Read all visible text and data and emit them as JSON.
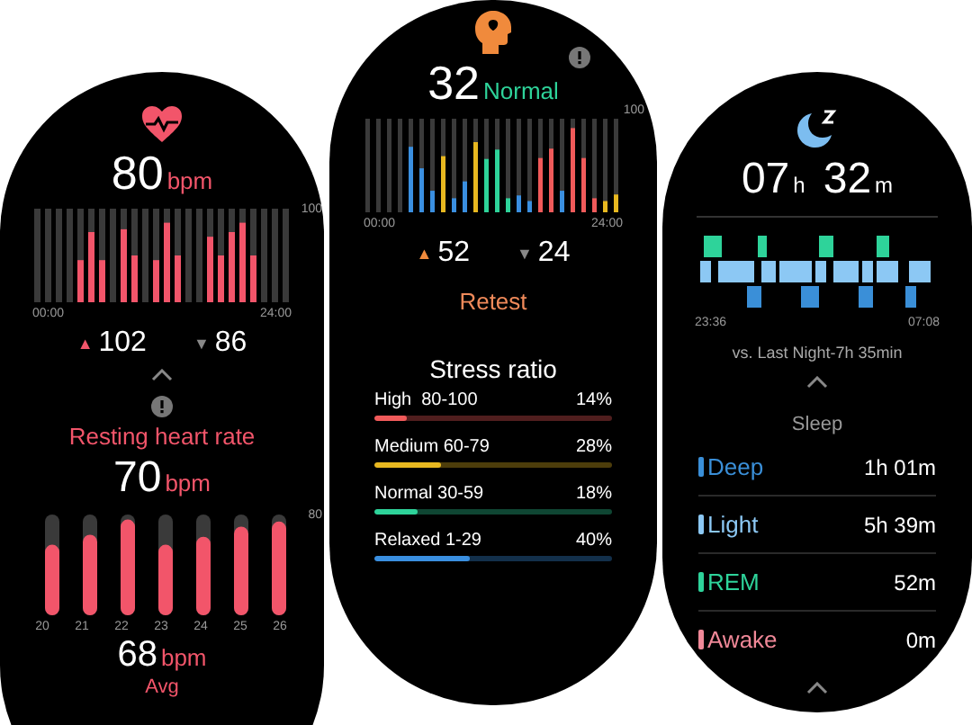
{
  "heart_rate": {
    "value": "80",
    "unit": "bpm",
    "time_start": "00:00",
    "time_end": "24:00",
    "scale_max": "100",
    "high": {
      "arrow": "▲",
      "value": "102"
    },
    "low": {
      "arrow": "▼",
      "value": "86"
    }
  },
  "resting": {
    "title": "Resting heart rate",
    "value": "70",
    "unit": "bpm",
    "scale_max": "80",
    "days": [
      "20",
      "21",
      "22",
      "23",
      "24",
      "25",
      "26"
    ],
    "avg_value": "68",
    "avg_unit": "bpm",
    "avg_label": "Avg"
  },
  "stress": {
    "value": "32",
    "status": "Normal",
    "time_start": "00:00",
    "time_end": "24:00",
    "scale_max": "100",
    "high": {
      "arrow": "▲",
      "value": "52"
    },
    "low": {
      "arrow": "▼",
      "value": "24"
    },
    "retest": "Retest",
    "ratio_title": "Stress ratio",
    "ratios": [
      {
        "label": "High  80-100",
        "percent": "14%",
        "level": 0.14,
        "color": "#f05a5a"
      },
      {
        "label": "Medium 60-79",
        "percent": "28%",
        "level": 0.28,
        "color": "#e8b820"
      },
      {
        "label": "Normal 30-59",
        "percent": "18%",
        "level": 0.18,
        "color": "#2ed39a"
      },
      {
        "label": "Relaxed 1-29",
        "percent": "40%",
        "level": 0.4,
        "color": "#3a8fe0"
      }
    ]
  },
  "sleep": {
    "hours": "07",
    "hours_unit": "h",
    "minutes": "32",
    "minutes_unit": "m",
    "time_start": "23:36",
    "time_end": "07:08",
    "comparison": "vs. Last Night-7h 35min",
    "title": "Sleep",
    "stages": [
      {
        "name": "Deep",
        "duration": "1h 01m",
        "color": "#3a8fd8"
      },
      {
        "name": "Light",
        "duration": "5h 39m",
        "color": "#8cc8f4"
      },
      {
        "name": "REM",
        "duration": "52m",
        "color": "#2ed39a"
      },
      {
        "name": "Awake",
        "duration": "0m",
        "color": "#f08898"
      }
    ]
  }
}
